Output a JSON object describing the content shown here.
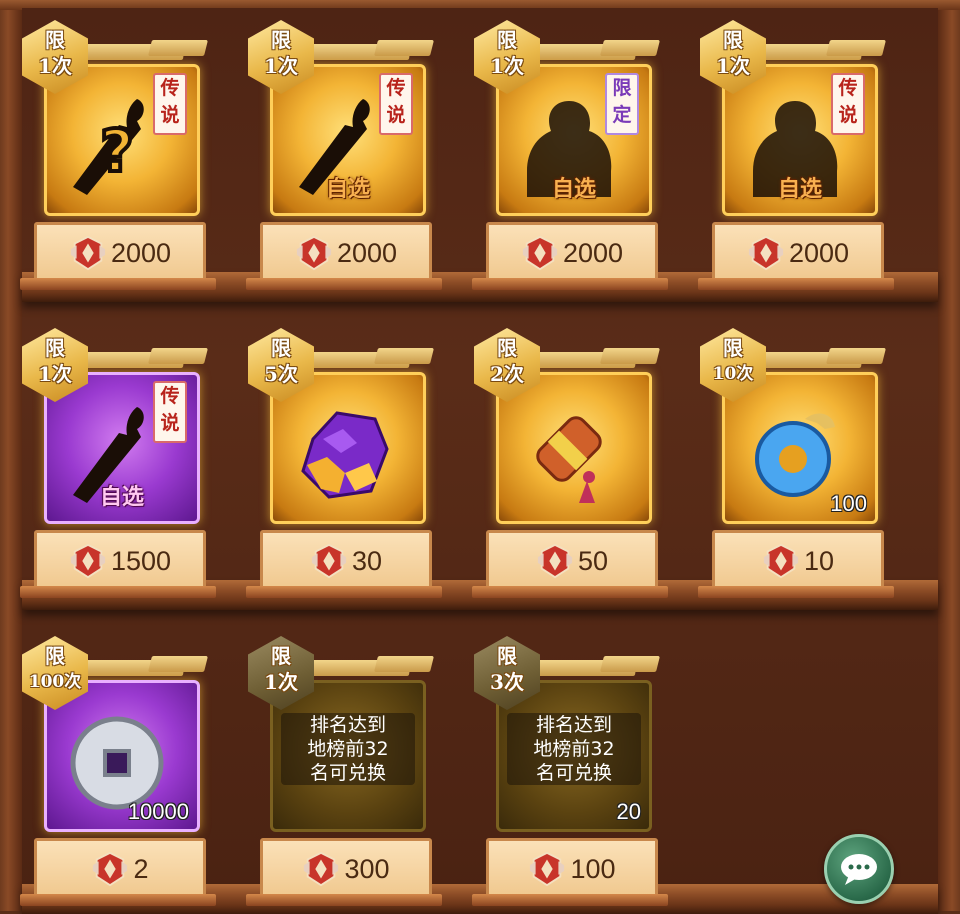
{
  "shop": {
    "items": [
      {
        "badge": [
          "限",
          "1次"
        ],
        "tag": "传说",
        "choice": "",
        "count": "",
        "locked": "",
        "price": "2000",
        "frame": "gold",
        "art": "question-weapon-icon"
      },
      {
        "badge": [
          "限",
          "1次"
        ],
        "tag": "传说",
        "choice": "自选",
        "count": "",
        "locked": "",
        "price": "2000",
        "frame": "gold",
        "art": "weapon-silhouette-icon"
      },
      {
        "badge": [
          "限",
          "1次"
        ],
        "tag": "限定",
        "choice": "自选",
        "count": "",
        "locked": "",
        "price": "2000",
        "frame": "gold",
        "art": "hero-silhouette-icon"
      },
      {
        "badge": [
          "限",
          "1次"
        ],
        "tag": "传说",
        "choice": "自选",
        "count": "",
        "locked": "",
        "price": "2000",
        "frame": "gold",
        "art": "hero-silhouette-icon"
      },
      {
        "badge": [
          "限",
          "1次"
        ],
        "tag": "传说",
        "choice": "自选",
        "count": "",
        "locked": "",
        "price": "1500",
        "frame": "purple",
        "art": "weapon-silhouette-icon"
      },
      {
        "badge": [
          "限",
          "5次"
        ],
        "tag": "",
        "choice": "",
        "count": "",
        "locked": "",
        "price": "30",
        "frame": "gold",
        "art": "crystal-icon"
      },
      {
        "badge": [
          "限",
          "2次"
        ],
        "tag": "",
        "choice": "",
        "count": "",
        "locked": "",
        "price": "50",
        "frame": "gold",
        "art": "scroll-icon"
      },
      {
        "badge": [
          "限",
          "10次"
        ],
        "tag": "",
        "choice": "",
        "count": "100",
        "locked": "",
        "price": "10",
        "frame": "gold",
        "art": "jade-ring-icon"
      },
      {
        "badge": [
          "限",
          "100次"
        ],
        "tag": "",
        "choice": "",
        "count": "10000",
        "locked": "",
        "price": "2",
        "frame": "purple",
        "art": "silver-coin-icon"
      },
      {
        "badge": [
          "限",
          "1次"
        ],
        "tag": "",
        "choice": "",
        "count": "",
        "locked": "排名达到\n地榜前32\n名可兑换",
        "price": "300",
        "frame": "dim",
        "art": ""
      },
      {
        "badge": [
          "限",
          "3次"
        ],
        "tag": "",
        "choice": "",
        "count": "20",
        "locked": "排名达到\n地榜前32\n名可兑换",
        "price": "100",
        "frame": "dim",
        "art": ""
      }
    ]
  },
  "currency_icon": "medal-icon",
  "chat_icon": "chat-bubble-icon",
  "colors": {
    "gold": "#f3b435",
    "purple": "#9a3ad0",
    "wood": "#5a2c18",
    "price_text": "#4a2a12"
  }
}
